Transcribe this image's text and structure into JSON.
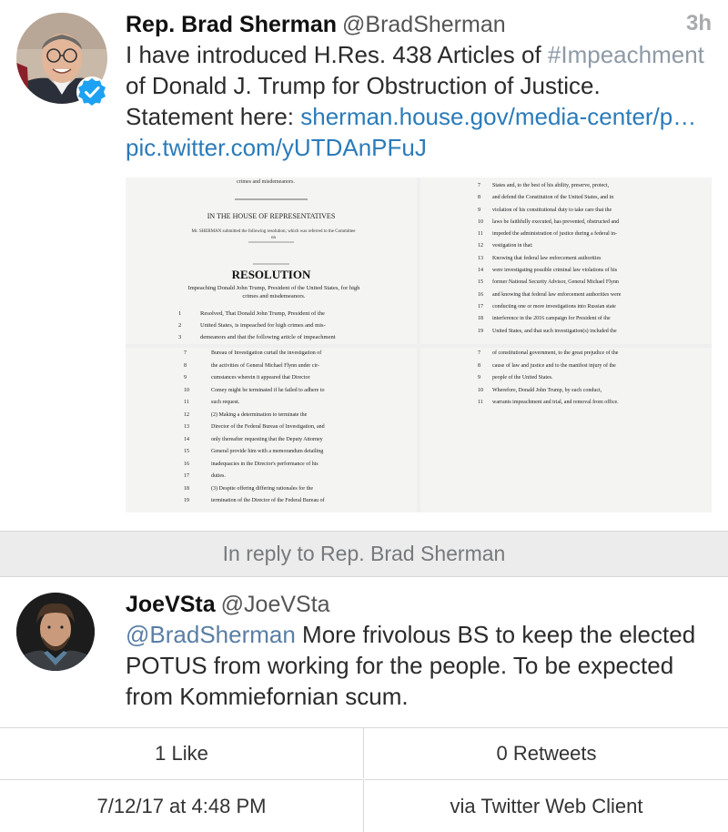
{
  "tweet1": {
    "name": "Rep. Brad Sherman",
    "handle": "@BradSherman",
    "time": "3h",
    "text_before": "I have introduced H.Res. 438 Articles of ",
    "hashtag": "#Impeachment",
    "text_after": " of Donald J. Trump for Obstruction of Justice. Statement here: ",
    "link1": "sherman.house.gov/media-center/p…",
    "link2": "pic.twitter.com/yUTDAnPFuJ",
    "document": {
      "page1_header": "crimes and misdemeanors.",
      "page1_house": "IN THE HOUSE OF REPRESENTATIVES",
      "page1_submitted": "Mr. SHERMAN submitted the following resolution; which was referred to the Committee on",
      "page1_resolution": "RESOLUTION",
      "page1_subtitle": "Impeaching Donald John Trump, President of the United States, for high crimes and misdemeanors.",
      "page1_lines": [
        {
          "n": "1",
          "t": "Resolved, That Donald John Trump, President of the"
        },
        {
          "n": "2",
          "t": "United States, is impeached for high crimes and mis-"
        },
        {
          "n": "3",
          "t": "demeanors and that the following article of impeachment"
        }
      ],
      "page2_lines": [
        {
          "n": "7",
          "t": "States and, to the best of his ability, preserve, protect,"
        },
        {
          "n": "8",
          "t": "and defend the Constitution of the United States, and in"
        },
        {
          "n": "9",
          "t": "violation of his constitutional duty to take care that the"
        },
        {
          "n": "10",
          "t": "laws be faithfully executed, has prevented, obstructed and"
        },
        {
          "n": "11",
          "t": "impeded the administration of justice during a federal in-"
        },
        {
          "n": "12",
          "t": "vestigation in that:"
        },
        {
          "n": "13",
          "t": "Knowing that federal law enforcement authorities"
        },
        {
          "n": "14",
          "t": "were investigating possible criminal law violations of his"
        },
        {
          "n": "15",
          "t": "former National Security Advisor, General Michael Flynn"
        },
        {
          "n": "16",
          "t": "and knowing that federal law enforcement authorities were"
        },
        {
          "n": "17",
          "t": "conducting one or more investigations into Russian state"
        },
        {
          "n": "18",
          "t": "interference in the 2016 campaign for President of the"
        },
        {
          "n": "19",
          "t": "United States, and that such investigation(s) included the"
        }
      ],
      "page3_lines": [
        {
          "n": "7",
          "t": "Bureau of Investigation curtail the investigation of"
        },
        {
          "n": "8",
          "t": "the activities of General Michael Flynn under cir-"
        },
        {
          "n": "9",
          "t": "cumstances wherein it appeared that Director"
        },
        {
          "n": "10",
          "t": "Comey might be terminated if he failed to adhere to"
        },
        {
          "n": "11",
          "t": "such request."
        },
        {
          "n": "12",
          "t": "(2) Making a determination to terminate the"
        },
        {
          "n": "13",
          "t": "Director of the Federal Bureau of Investigation, and"
        },
        {
          "n": "14",
          "t": "only thereafter requesting that the Deputy Attorney"
        },
        {
          "n": "15",
          "t": "General provide him with a memorandum detailing"
        },
        {
          "n": "16",
          "t": "inadequacies in the Director's performance of his"
        },
        {
          "n": "17",
          "t": "duties."
        },
        {
          "n": "18",
          "t": "(3) Despite offering differing rationales for the"
        },
        {
          "n": "19",
          "t": "termination of the Director of the Federal Bureau of"
        }
      ],
      "page4_lines": [
        {
          "n": "7",
          "t": "of constitutional government, to the great prejudice of the"
        },
        {
          "n": "8",
          "t": "cause of law and justice and to the manifest injury of the"
        },
        {
          "n": "9",
          "t": "people of the United States."
        },
        {
          "n": "10",
          "t": "Wherefore, Donald John Trump, by such conduct,"
        },
        {
          "n": "11",
          "t": "warrants impeachment and trial, and removal from office."
        }
      ]
    }
  },
  "reply_bar": "In reply to Rep. Brad Sherman",
  "tweet2": {
    "name": "JoeVSta",
    "handle": "@JoeVSta",
    "mention": "@BradSherman",
    "text": " More frivolous BS to keep the elected POTUS from working for the people. To be expected from Kommiefornian scum."
  },
  "stats": {
    "likes": "1 Like",
    "retweets": "0 Retweets",
    "datetime": "7/12/17 at 4:48 PM",
    "via": "via Twitter Web Client"
  },
  "colors": {
    "link": "#2b7bb9",
    "verified": "#1da1f2"
  }
}
